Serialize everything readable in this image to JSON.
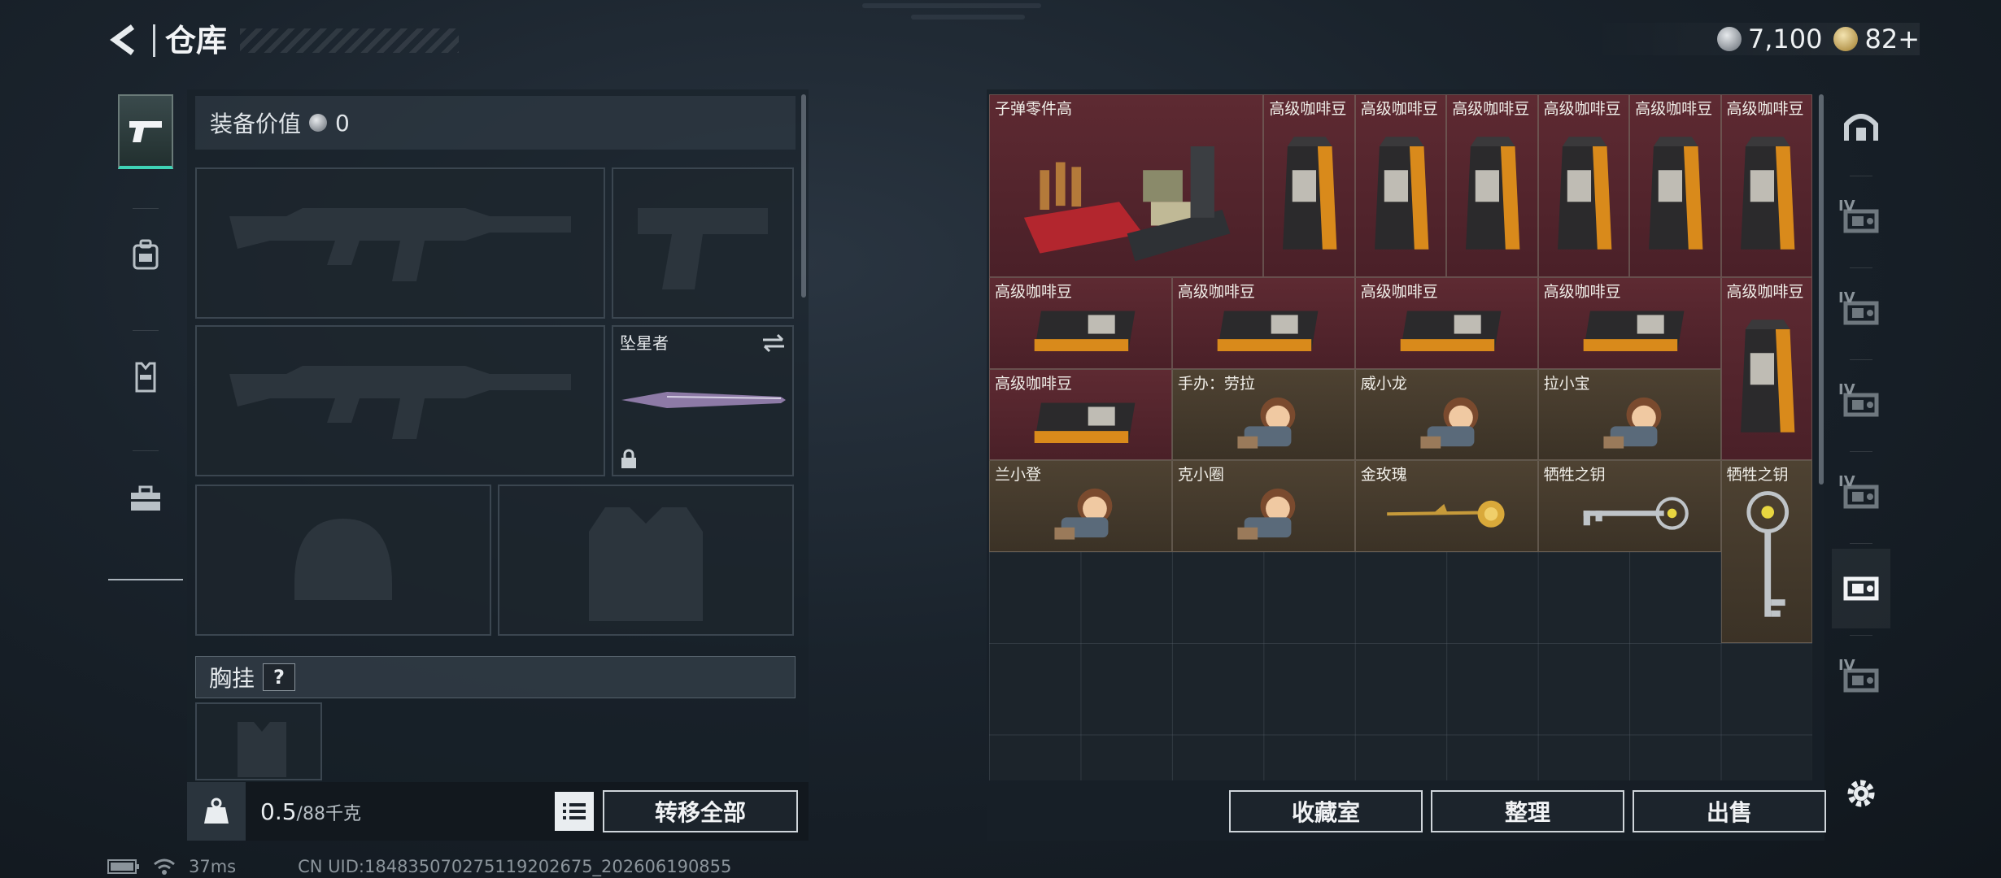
{
  "header": {
    "title": "仓库",
    "currency": {
      "silver": "7,100",
      "gold": "82+"
    }
  },
  "rail": {
    "tabs": [
      {
        "name": "pistol-icon",
        "active": true
      },
      {
        "name": "backpack-icon"
      },
      {
        "name": "vest-icon"
      },
      {
        "name": "toolbox-icon"
      }
    ]
  },
  "equipment": {
    "value_label": "装备价值",
    "value": "0",
    "melee_name": "坠星者",
    "chest_label": "胸挂",
    "chest_help": "?",
    "weight_value": "0.5",
    "weight_max": "/88千克",
    "transfer_all": "转移全部"
  },
  "stash": {
    "items": [
      {
        "label": "子弹零件高",
        "type": "ammo"
      },
      {
        "label": "高级咖啡豆",
        "type": "coffee-bag"
      },
      {
        "label": "高级咖啡豆",
        "type": "coffee-bag"
      },
      {
        "label": "高级咖啡豆",
        "type": "coffee-bag"
      },
      {
        "label": "高级咖啡豆",
        "type": "coffee-bag"
      },
      {
        "label": "高级咖啡豆",
        "type": "coffee-bag"
      },
      {
        "label": "高级咖啡豆",
        "type": "coffee-bag"
      },
      {
        "label": "高级咖啡豆",
        "type": "coffee-flat"
      },
      {
        "label": "高级咖啡豆",
        "type": "coffee-flat"
      },
      {
        "label": "高级咖啡豆",
        "type": "coffee-flat"
      },
      {
        "label": "高级咖啡豆",
        "type": "coffee-flat"
      },
      {
        "label": "高级咖啡豆",
        "type": "coffee-bag"
      },
      {
        "label": "高级咖啡豆",
        "type": "coffee-flat"
      },
      {
        "label": "手办：劳拉",
        "type": "figure"
      },
      {
        "label": "威小龙",
        "type": "figure"
      },
      {
        "label": "拉小宝",
        "type": "figure"
      },
      {
        "label": "兰小登",
        "type": "figure"
      },
      {
        "label": "克小圈",
        "type": "figure"
      },
      {
        "label": "金玫瑰",
        "type": "rose"
      },
      {
        "label": "牺牲之钥",
        "type": "key"
      },
      {
        "label": "牺牲之钥",
        "type": "key-vertical"
      }
    ],
    "buttons": {
      "collection": "收藏室",
      "sort": "整理",
      "sell": "出售"
    }
  },
  "right_rail": {
    "tabs": [
      {
        "name": "safe-room-icon"
      },
      {
        "name": "stash-iv-icon",
        "tier": "IV"
      },
      {
        "name": "stash-add-iv-icon",
        "tier": "IV"
      },
      {
        "name": "stash-iv-icon-2",
        "tier": "IV"
      },
      {
        "name": "stash-iv-icon-3",
        "tier": "IV"
      },
      {
        "name": "stash-selected-icon",
        "active": true
      },
      {
        "name": "stash-iv-icon-4",
        "tier": "IV"
      }
    ]
  },
  "status": {
    "ping": "37ms",
    "uid": "CN UID:184835070275119202675_202606190855"
  }
}
